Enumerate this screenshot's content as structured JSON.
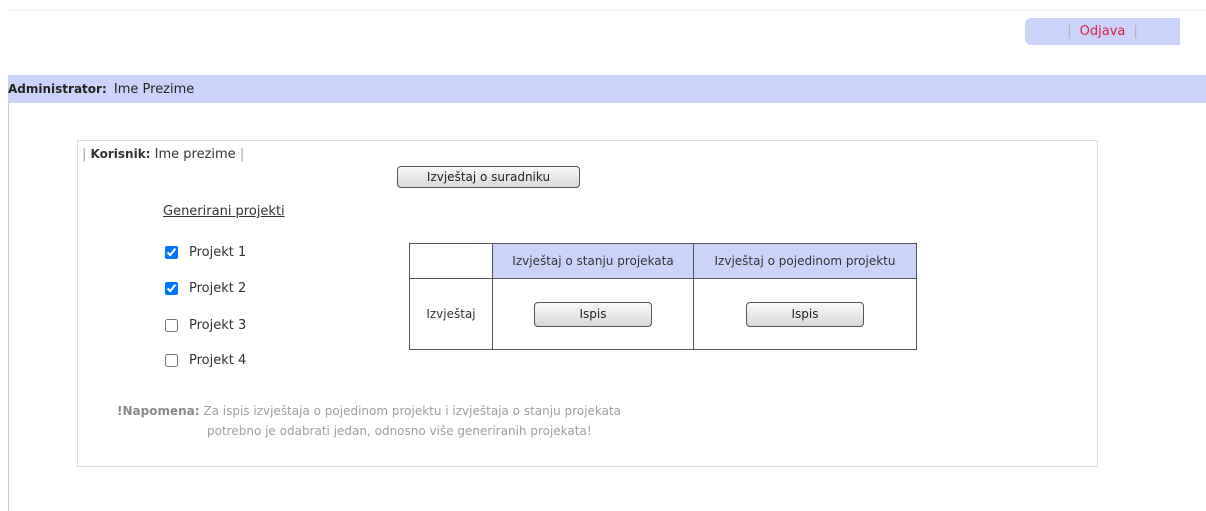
{
  "header": {
    "pipe_left": "|",
    "logout_label": "Odjava",
    "pipe_right": "|"
  },
  "admin_bar": {
    "label": "Administrator:",
    "name": "Ime Prezime"
  },
  "panel": {
    "user_pipe_left": "|",
    "user_label": "Korisnik:",
    "user_name": "Ime prezime",
    "user_pipe_right": "|",
    "collaborator_report_button": "Izvještaj o suradniku",
    "projects_title": "Generirani projekti",
    "projects": [
      {
        "label": "Projekt 1",
        "checked": true
      },
      {
        "label": "Projekt 2",
        "checked": true
      },
      {
        "label": "Projekt 3",
        "checked": false
      },
      {
        "label": "Projekt 4",
        "checked": false
      }
    ],
    "report_table": {
      "col1_header": "Izvještaj o stanju projekata",
      "col2_header": "Izvještaj o pojedinom projektu",
      "row_label": "Izvještaj",
      "print_button_1": "Ispis",
      "print_button_2": "Ispis"
    },
    "note": {
      "label": "!Napomena:",
      "line1": "Za ispis izvještaja o pojedinom projektu i izvještaja o stanju projekata",
      "line2": "potrebno je odabrati jedan, odnosno više generiranih projekata!"
    }
  },
  "colors": {
    "bar_background": "#ccd3fb",
    "logout_link": "#e0204a",
    "note_text": "#a0a0a0"
  }
}
